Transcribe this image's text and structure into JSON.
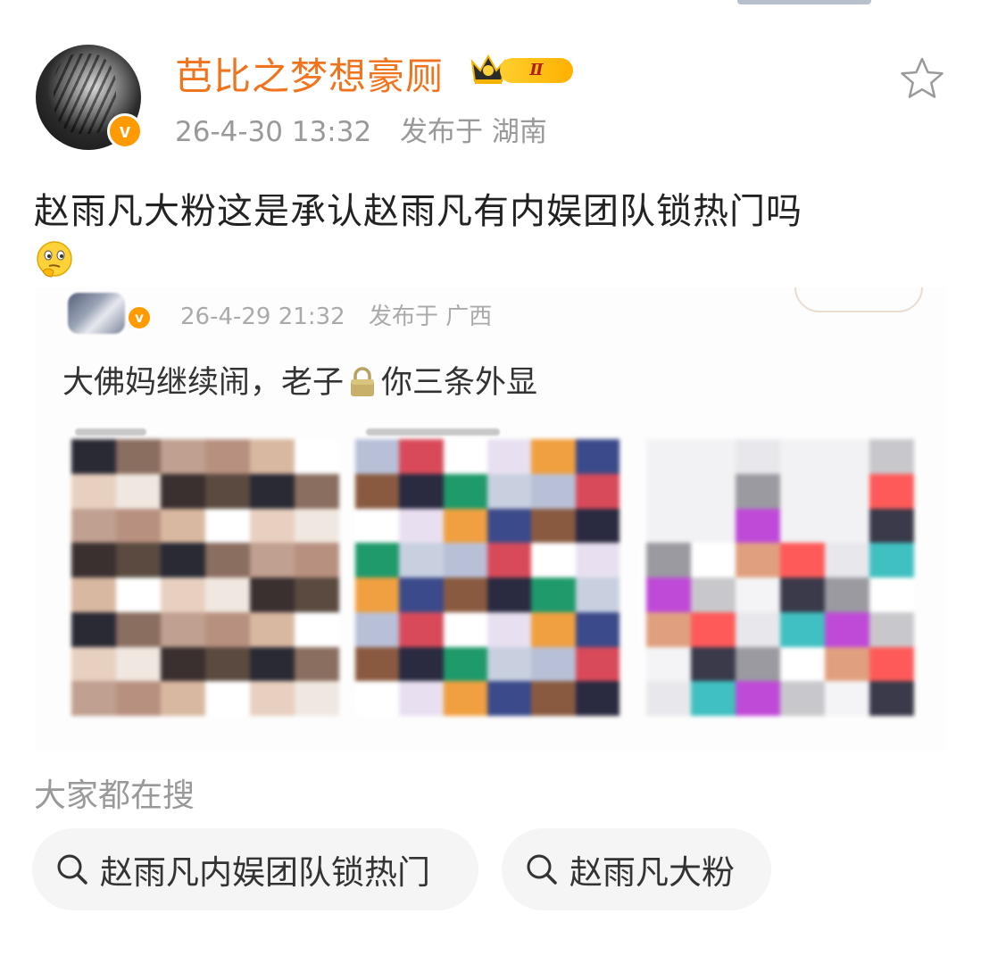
{
  "post": {
    "username": "芭比之梦想豪厕",
    "vip_level": "Ⅱ",
    "timestamp": "26-4-30 13:32",
    "location": "发布于 湖南",
    "text": "赵雨凡大粉这是承认赵雨凡有内娱团队锁热门吗",
    "emoji": "thinking-face-icon"
  },
  "quoted_image": {
    "timestamp": "26-4-29 21:32",
    "location": "发布于 广西",
    "text_before": "大佛妈继续闹，老子",
    "text_after": "你三条外显"
  },
  "search": {
    "heading": "大家都在搜",
    "chips": [
      {
        "label": "赵雨凡内娱团队锁热门",
        "icon": "search-icon"
      },
      {
        "label": "赵雨凡大粉",
        "icon": "search-icon"
      }
    ]
  },
  "colors": {
    "username": "#f0731e",
    "verify_badge": "#ff9a00",
    "meta": "#999999",
    "chip_background": "#f5f5f5"
  }
}
